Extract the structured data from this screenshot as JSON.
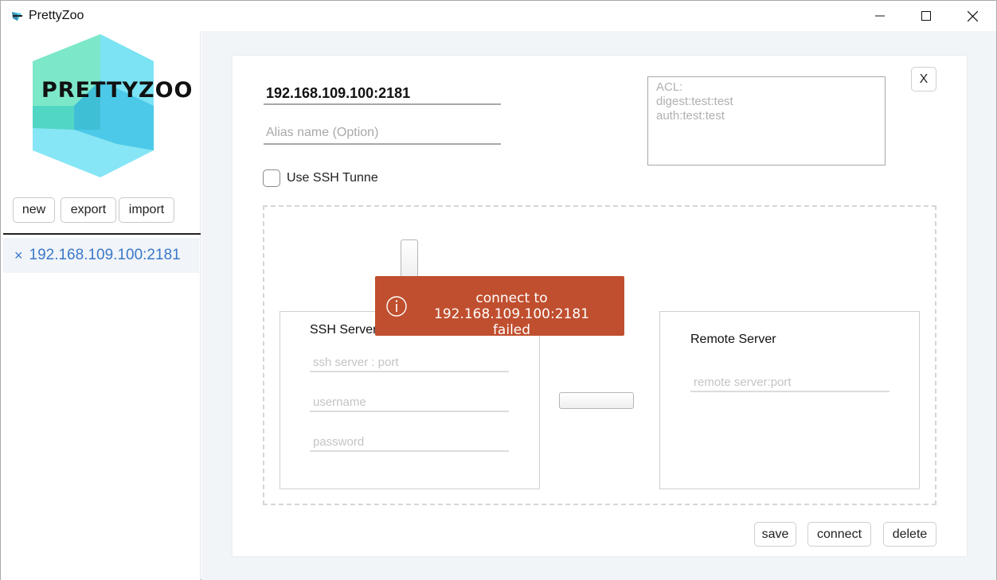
{
  "window": {
    "title": "PrettyZoo",
    "minimize_icon": "minimize-icon",
    "maximize_icon": "maximize-icon",
    "close_icon": "close-icon"
  },
  "sidebar": {
    "logo_text": "PRETTYZOO",
    "logo_colors": [
      "#7de8c9",
      "#52d6c4",
      "#4cc9e8",
      "#86e6f5"
    ],
    "buttons": {
      "new": "new",
      "export": "export",
      "import": "import"
    },
    "servers": [
      {
        "remove_symbol": "×",
        "label": "192.168.109.100:2181"
      }
    ]
  },
  "form": {
    "host_value": "192.168.109.100:2181",
    "alias_placeholder": "Alias name (Option)",
    "acl_placeholder": "ACL:\ndigest:test:test\nauth:test:test",
    "close_label": "X",
    "ssh_checkbox_label": "Use SSH Tunne",
    "ssh_checked": false,
    "ssh_server": {
      "title": "SSH Server",
      "server_placeholder": "ssh server : port",
      "username_placeholder": "username",
      "password_placeholder": "password"
    },
    "remote_server": {
      "title": "Remote Server",
      "server_placeholder": "remote server:port"
    },
    "actions": {
      "save": "save",
      "connect": "connect",
      "delete": "delete"
    }
  },
  "toast": {
    "icon": "info-icon",
    "line1": "connect to",
    "line2": "192.168.109.100:2181 failed",
    "color": "#c04f2f"
  },
  "colors": {
    "accent_link": "#3a78c9",
    "main_background": "#f2f5f8"
  }
}
